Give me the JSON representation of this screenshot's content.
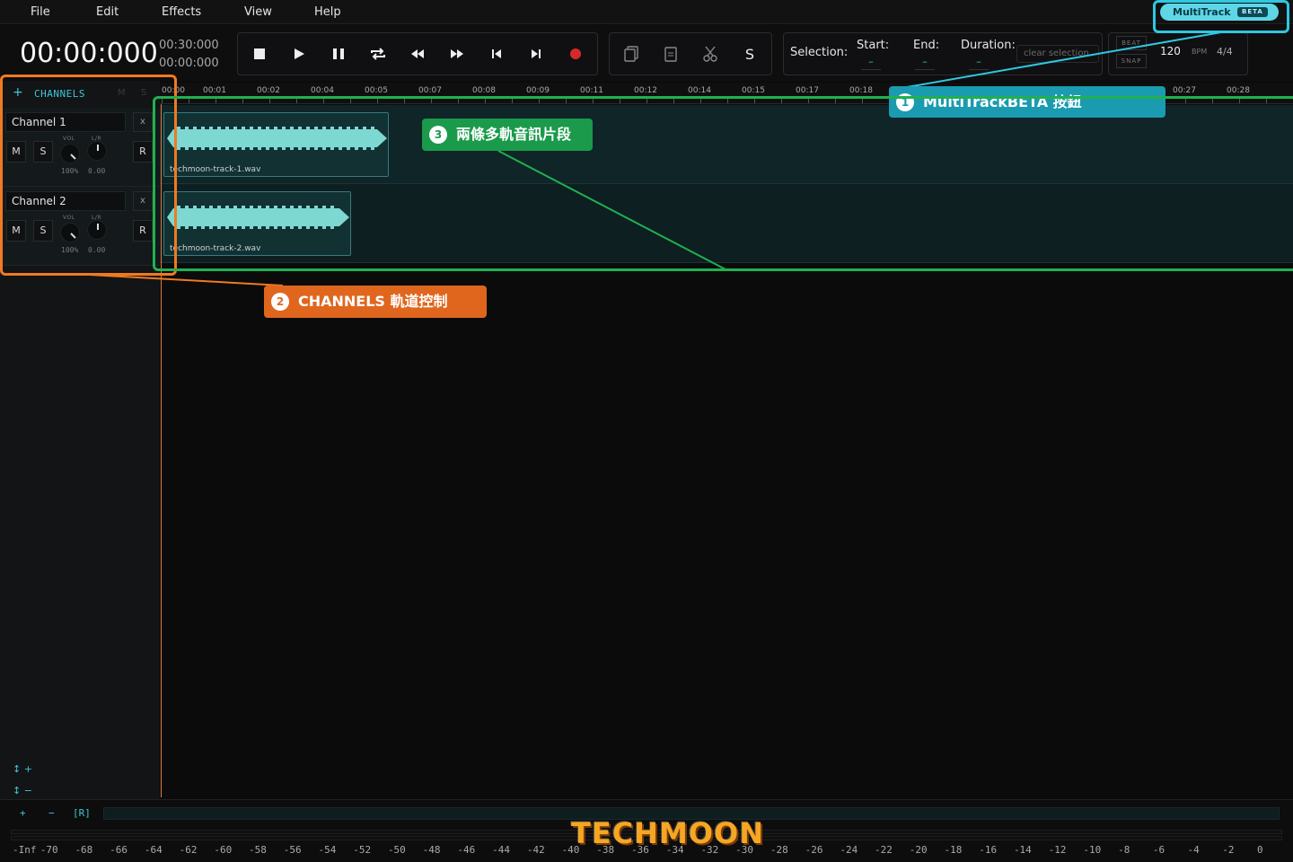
{
  "menu": {
    "items": [
      "File",
      "Edit",
      "Effects",
      "View",
      "Help"
    ]
  },
  "multitrack_button": {
    "label": "MultiTrack",
    "badge": "BETA"
  },
  "transport": {
    "time": "00:00:000",
    "duration": "00:30:000",
    "position": "00:00:000"
  },
  "selection": {
    "label": "Selection:",
    "start_label": "Start:",
    "start_value": "–",
    "end_label": "End:",
    "end_value": "–",
    "duration_label": "Duration:",
    "duration_value": "–",
    "clear_label": "clear selection"
  },
  "tempo": {
    "beat_label": "BEAT",
    "snap_label": "SNAP",
    "bpm": "120",
    "bpm_label": "BPM",
    "signature": "4/4"
  },
  "channels_panel": {
    "add": "+",
    "title": "CHANNELS",
    "m_header": "M",
    "s_header": "S",
    "channels": [
      {
        "name": "Channel 1",
        "remove": "x",
        "mute": "M",
        "solo": "S",
        "record": "R",
        "vol_label": "VOL",
        "pan_label": "L/R",
        "vol_value": "100%",
        "pan_value": "0.00"
      },
      {
        "name": "Channel 2",
        "remove": "x",
        "mute": "M",
        "solo": "S",
        "record": "R",
        "vol_label": "VOL",
        "pan_label": "L/R",
        "vol_value": "100%",
        "pan_value": "0.00"
      }
    ],
    "zoom_in": "↕ +",
    "zoom_out": "↕ −"
  },
  "ruler": {
    "ticks": [
      "00:00",
      "00:01",
      "00:02",
      "00:04",
      "00:05",
      "00:07",
      "00:08",
      "00:09",
      "00:11",
      "00:12",
      "00:14",
      "00:15",
      "00:17",
      "00:18",
      "00:27",
      "00:28"
    ]
  },
  "clips": [
    {
      "name": "techmoon-track-1.wav",
      "track": 1
    },
    {
      "name": "techmoon-track-2.wav",
      "track": 2
    }
  ],
  "bottom": {
    "add": "+",
    "remove": "−",
    "record": "[R]",
    "db_scale": [
      "-Inf",
      "-70",
      "-68",
      "-66",
      "-64",
      "-62",
      "-60",
      "-58",
      "-56",
      "-54",
      "-52",
      "-50",
      "-48",
      "-46",
      "-44",
      "-42",
      "-40",
      "-38",
      "-36",
      "-34",
      "-32",
      "-30",
      "-28",
      "-26",
      "-24",
      "-22",
      "-20",
      "-18",
      "-16",
      "-14",
      "-12",
      "-10",
      "-8",
      "-6",
      "-4",
      "-2",
      "0"
    ]
  },
  "logo_text": "TECHMOON",
  "annotations": [
    {
      "number": "1",
      "text": "MultiTrackBETA 按鈕",
      "color": "#1a9bb0"
    },
    {
      "number": "2",
      "text": "CHANNELS 軌道控制",
      "color": "#e0661e"
    },
    {
      "number": "3",
      "text": "兩條多軌音訊片段",
      "color": "#1a9a4a"
    }
  ],
  "colors": {
    "accent": "#3ec6d6",
    "waveform": "#7dd8d2",
    "playhead": "#e07a3a",
    "annotation_cyan": "#2ec8e0",
    "annotation_orange": "#f07a20",
    "annotation_green": "#20b050"
  }
}
